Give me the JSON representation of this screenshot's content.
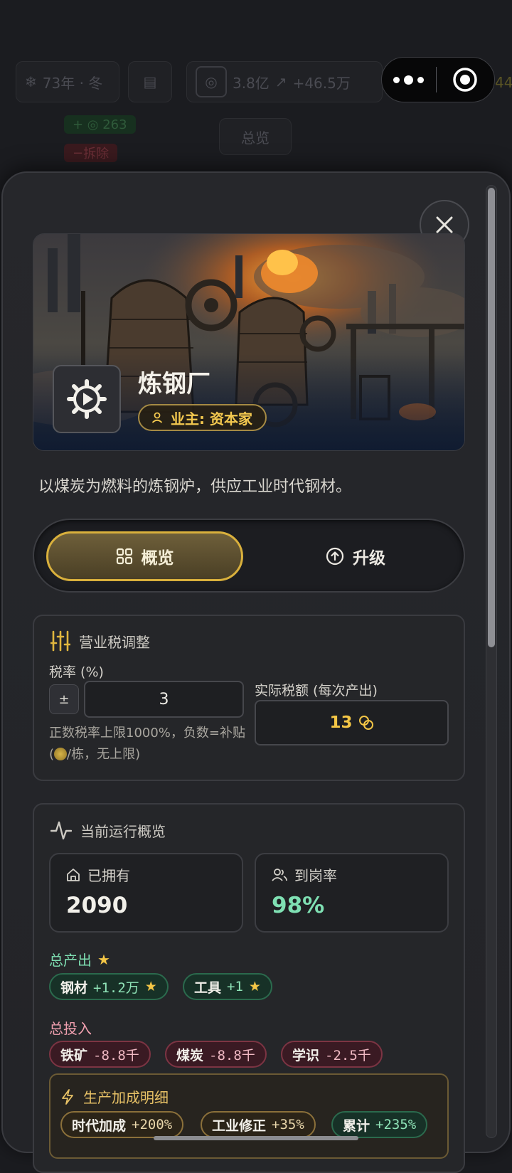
{
  "background": {
    "year_chip": "73年 · 冬",
    "money": "3.8亿",
    "money_trend": "+46.5万",
    "right_num": "44",
    "demolish": "拆除",
    "green_num": "263",
    "overview_btn": "总览"
  },
  "building": {
    "name": "炼钢厂",
    "owner": "业主: 资本家",
    "description": "以煤炭为燃料的炼钢炉，供应工业时代钢材。",
    "icon": "gear-play-icon"
  },
  "tabs": [
    {
      "label": "概览",
      "icon": "grid-icon",
      "active": true
    },
    {
      "label": "升级",
      "icon": "arrow-up-circle-icon",
      "active": false
    }
  ],
  "tax": {
    "title": "营业税调整",
    "rate_label": "税率 (%)",
    "sign_btn": "±",
    "rate_value": "3",
    "hint_a": "正数税率上限1000%，负数=补贴(",
    "hint_b": "/栋，无上限)",
    "actual_label": "实际税额 (每次产出)",
    "actual_value": "13"
  },
  "overview": {
    "title": "当前运行概览",
    "owned_label": "已拥有",
    "owned_value": "2090",
    "attendance_label": "到岗率",
    "attendance_value": "98%",
    "output_label": "总产出",
    "outputs": [
      {
        "name": "钢材",
        "value": "+1.2万"
      },
      {
        "name": "工具",
        "value": "+1"
      }
    ],
    "input_label": "总投入",
    "inputs": [
      {
        "name": "铁矿",
        "value": "-8.8千"
      },
      {
        "name": "煤炭",
        "value": "-8.8千"
      },
      {
        "name": "学识",
        "value": "-2.5千"
      }
    ],
    "bonus_title": "生产加成明细",
    "bonuses": [
      {
        "name": "时代加成",
        "value": "+200%"
      },
      {
        "name": "工业修正",
        "value": "+35%"
      },
      {
        "name": "累计",
        "value": "+235%"
      }
    ]
  },
  "colors": {
    "accent_gold": "#d9b03c",
    "output_green": "#8fe3b7",
    "input_red": "#f0b9c3",
    "tax_gold": "#f4c646"
  }
}
